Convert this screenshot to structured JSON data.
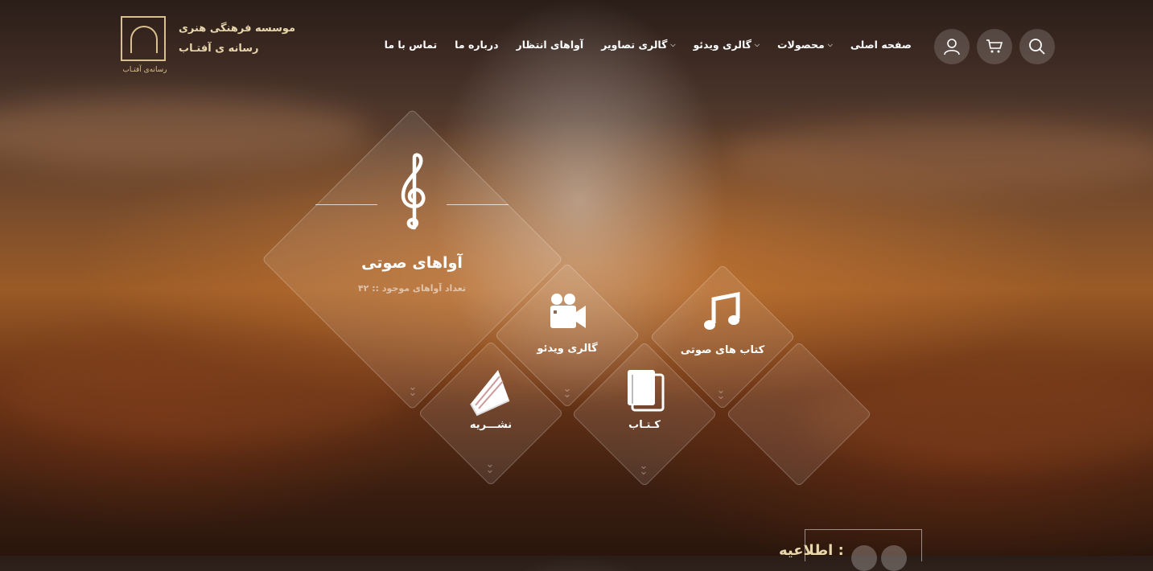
{
  "brand": {
    "line1": "موسسه فرهنگی هنری",
    "line2": "رسانه ی آفتـاب",
    "caption": "رسانه‌ی آفتـاب",
    "color": "#d9c08e"
  },
  "nav": [
    {
      "label": "صفحه اصلی",
      "dropdown": false
    },
    {
      "label": "محصولات",
      "dropdown": true
    },
    {
      "label": "گالری ویدئو",
      "dropdown": true
    },
    {
      "label": "گالری تصاویر",
      "dropdown": true
    },
    {
      "label": "آواهای انتظار",
      "dropdown": false
    },
    {
      "label": "درباره ما",
      "dropdown": false
    },
    {
      "label": "تماس با ما",
      "dropdown": false
    }
  ],
  "header_icons": [
    "search-icon",
    "cart-icon",
    "user-icon"
  ],
  "tiles": {
    "main": {
      "title": "آواهای صوتی",
      "subtitle": "تعداد آواهای موجود :: ۴۲",
      "icon": "treble-clef-icon"
    },
    "video": {
      "label": "گالری ویدئو",
      "icon": "video-camera-icon"
    },
    "audiobooks": {
      "label": "کتاب های صوتی",
      "icon": "music-note-icon"
    },
    "magazine": {
      "label": "نشـــریه",
      "icon": "magazine-icon"
    },
    "book": {
      "label": "کـتـاب",
      "icon": "book-icon"
    }
  },
  "notice": {
    "label": "اطلاعیه :"
  }
}
